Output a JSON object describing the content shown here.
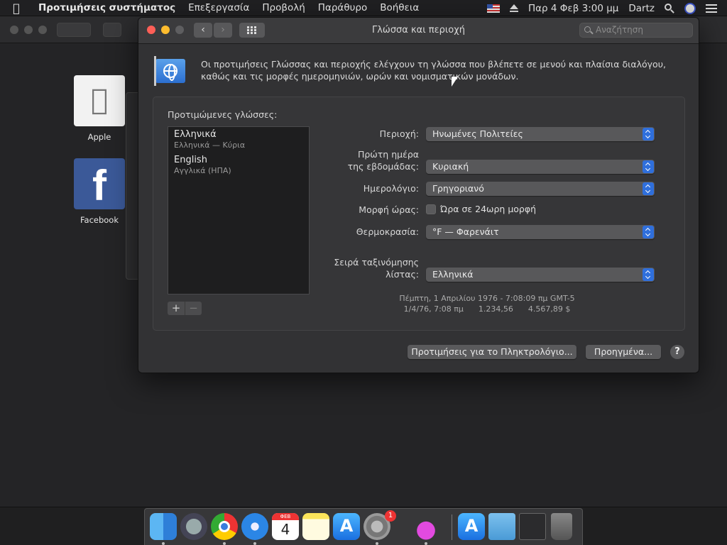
{
  "menubar": {
    "app_name": "Προτιμήσεις συστήματος",
    "menus": [
      "Επεξεργασία",
      "Προβολή",
      "Παράθυρο",
      "Βοήθεια"
    ],
    "clock": "Παρ 4 Φεβ  3:00 μμ",
    "user": "Dartz"
  },
  "background": {
    "apps": [
      {
        "label": "Apple"
      },
      {
        "label": "Facebook"
      }
    ]
  },
  "window": {
    "title": "Γλώσσα και περιοχή",
    "search_placeholder": "Αναζήτηση",
    "description": "Οι προτιμήσεις Γλώσσας και περιοχής ελέγχουν τη γλώσσα που βλέπετε σε μενού και πλαίσια διαλόγου, καθώς και τις μορφές ημερομηνιών, ωρών και νομισματικών μονάδων.",
    "preferred_languages_label": "Προτιμώμενες γλώσσες:",
    "languages": [
      {
        "name": "Ελληνικά",
        "sub": "Ελληνικά — Κύρια"
      },
      {
        "name": "English",
        "sub": "Αγγλικά (ΗΠΑ)"
      }
    ],
    "add_label": "+",
    "remove_label": "−",
    "fields": {
      "region_label": "Περιοχή:",
      "region_value": "Ηνωμένες Πολιτείες",
      "first_day_label_1": "Πρώτη ημέρα",
      "first_day_label_2": "της εβδομάδας:",
      "first_day_value": "Κυριακή",
      "calendar_label": "Ημερολόγιο:",
      "calendar_value": "Γρηγοριανό",
      "time_format_label": "Μορφή ώρας:",
      "time_format_checkbox": "Ώρα σε 24ωρη μορφή",
      "temperature_label": "Θερμοκρασία:",
      "temperature_value": "°F — Φαρενάιτ",
      "sort_order_label_1": "Σειρά ταξινόμησης",
      "sort_order_label_2": "λίστας:",
      "sort_order_value": "Ελληνικά"
    },
    "sample_line_1": "Πέμπτη, 1 Απριλίου 1976 - 7:08:09 πμ GMT-5",
    "sample_line_2": "1/4/76, 7:08 πμ      1.234,56      4.567,89 $",
    "keyboard_button": "Προτιμήσεις για το Πληκτρολόγιο...",
    "advanced_button": "Προηγμένα...",
    "help_label": "?"
  },
  "dock": {
    "calendar_month": "ΦΕΒ",
    "calendar_day": "4",
    "badge_count": "1"
  },
  "colors": {
    "accent": "#2f6fdc",
    "window_bg": "#323234",
    "close": "#fe5f57",
    "minimize": "#febc2e"
  }
}
